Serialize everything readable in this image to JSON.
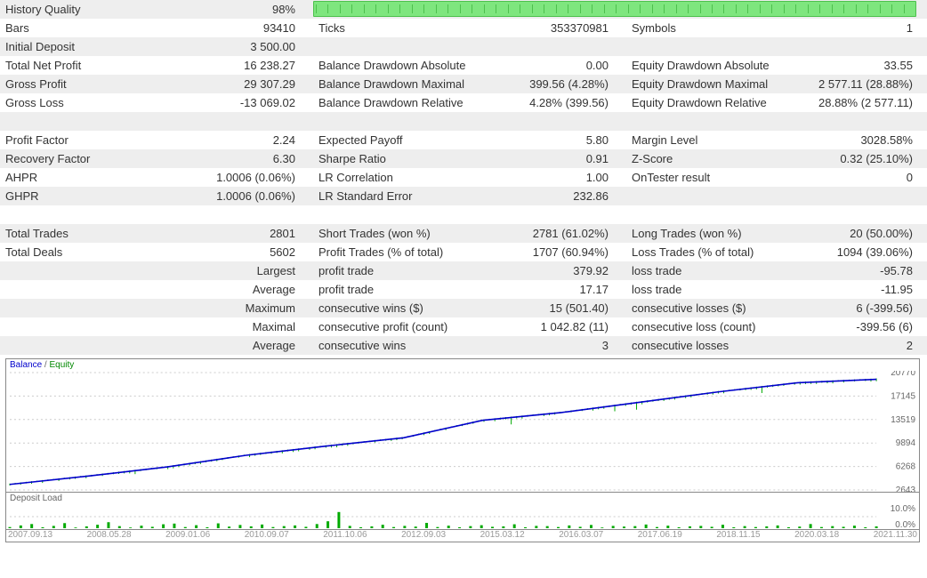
{
  "rows": [
    {
      "c1l": "History Quality",
      "c1v": "98%",
      "qbar": true
    },
    {
      "c1l": "Bars",
      "c1v": "93410",
      "c2l": "Ticks",
      "c2v": "353370981",
      "c3l": "Symbols",
      "c3v": "1"
    },
    {
      "c1l": "Initial Deposit",
      "c1v": "3 500.00",
      "c2l": "",
      "c2v": "",
      "c3l": "",
      "c3v": ""
    },
    {
      "c1l": "Total Net Profit",
      "c1v": "16 238.27",
      "c2l": "Balance Drawdown Absolute",
      "c2v": "0.00",
      "c3l": "Equity Drawdown Absolute",
      "c3v": "33.55"
    },
    {
      "c1l": "Gross Profit",
      "c1v": "29 307.29",
      "c2l": "Balance Drawdown Maximal",
      "c2v": "399.56 (4.28%)",
      "c3l": "Equity Drawdown Maximal",
      "c3v": "2 577.11 (28.88%)"
    },
    {
      "c1l": "Gross Loss",
      "c1v": "-13 069.02",
      "c2l": "Balance Drawdown Relative",
      "c2v": "4.28% (399.56)",
      "c3l": "Equity Drawdown Relative",
      "c3v": "28.88% (2 577.11)"
    },
    {
      "blank": true
    },
    {
      "c1l": "Profit Factor",
      "c1v": "2.24",
      "c2l": "Expected Payoff",
      "c2v": "5.80",
      "c3l": "Margin Level",
      "c3v": "3028.58%"
    },
    {
      "c1l": "Recovery Factor",
      "c1v": "6.30",
      "c2l": "Sharpe Ratio",
      "c2v": "0.91",
      "c3l": "Z-Score",
      "c3v": "0.32 (25.10%)"
    },
    {
      "c1l": "AHPR",
      "c1v": "1.0006 (0.06%)",
      "c2l": "LR Correlation",
      "c2v": "1.00",
      "c3l": "OnTester result",
      "c3v": "0"
    },
    {
      "c1l": "GHPR",
      "c1v": "1.0006 (0.06%)",
      "c2l": "LR Standard Error",
      "c2v": "232.86",
      "c3l": "",
      "c3v": ""
    },
    {
      "blank": true
    },
    {
      "c1l": "Total Trades",
      "c1v": "2801",
      "c2l": "Short Trades (won %)",
      "c2v": "2781 (61.02%)",
      "c3l": "Long Trades (won %)",
      "c3v": "20 (50.00%)"
    },
    {
      "c1l": "Total Deals",
      "c1v": "5602",
      "c2l": "Profit Trades (% of total)",
      "c2v": "1707 (60.94%)",
      "c3l": "Loss Trades (% of total)",
      "c3v": "1094 (39.06%)"
    },
    {
      "c1l": "",
      "c1v": "Largest",
      "c2l": "profit trade",
      "c2v": "379.92",
      "c3l": "loss trade",
      "c3v": "-95.78"
    },
    {
      "c1l": "",
      "c1v": "Average",
      "c2l": "profit trade",
      "c2v": "17.17",
      "c3l": "loss trade",
      "c3v": "-11.95"
    },
    {
      "c1l": "",
      "c1v": "Maximum",
      "c2l": "consecutive wins ($)",
      "c2v": "15 (501.40)",
      "c3l": "consecutive losses ($)",
      "c3v": "6 (-399.56)"
    },
    {
      "c1l": "",
      "c1v": "Maximal",
      "c2l": "consecutive profit (count)",
      "c2v": "1 042.82 (11)",
      "c3l": "consecutive loss (count)",
      "c3v": "-399.56 (6)"
    },
    {
      "c1l": "",
      "c1v": "Average",
      "c2l": "consecutive wins",
      "c2v": "3",
      "c3l": "consecutive losses",
      "c3v": "2"
    }
  ],
  "chart": {
    "legend_balance": "Balance",
    "legend_sep": " / ",
    "legend_equity": "Equity",
    "deposit_label": "Deposit Load",
    "deposit_max": "10.0%",
    "deposit_min": "0.0%",
    "yticks": [
      "20770",
      "17145",
      "13519",
      "9894",
      "6268",
      "2643"
    ],
    "xticks": [
      "2007.09.13",
      "2008.05.28",
      "2009.01.06",
      "2010.09.07",
      "2011.10.06",
      "2012.09.03",
      "2015.03.12",
      "2016.03.07",
      "2017.06.19",
      "2018.11.15",
      "2020.03.18",
      "2021.11.30"
    ]
  },
  "chart_data": {
    "type": "line",
    "title": "Balance / Equity",
    "ylabel": "",
    "xlabel": "",
    "ylim_balance": [
      2643,
      20770
    ],
    "series": [
      {
        "name": "Balance",
        "x": [
          "2007.09.13",
          "2008.05.28",
          "2009.01.06",
          "2010.09.07",
          "2011.10.06",
          "2012.09.03",
          "2015.03.12",
          "2016.03.07",
          "2017.06.19",
          "2018.11.15",
          "2020.03.18",
          "2021.11.30"
        ],
        "values": [
          3500,
          4800,
          6200,
          8000,
          9400,
          10700,
          13400,
          14600,
          16200,
          17800,
          19200,
          19738
        ]
      },
      {
        "name": "Equity",
        "x": [
          "2007.09.13",
          "2008.05.28",
          "2009.01.06",
          "2010.09.07",
          "2011.10.06",
          "2012.09.03",
          "2015.03.12",
          "2016.03.07",
          "2017.06.19",
          "2018.11.15",
          "2020.03.18",
          "2021.11.30"
        ],
        "values": [
          3500,
          4700,
          6200,
          7900,
          9300,
          10600,
          13300,
          14500,
          16100,
          17700,
          19100,
          19738
        ]
      },
      {
        "name": "Deposit Load",
        "ylim": [
          0,
          10
        ],
        "values_pct": [
          0.5,
          1.2,
          1.8,
          0.4,
          1.0,
          2.2,
          0.3,
          0.8,
          1.5,
          2.6,
          0.9,
          0.3,
          1.1,
          0.6,
          1.7,
          2.0,
          0.5,
          1.3,
          0.4,
          2.1,
          0.7,
          1.4,
          0.8,
          1.6,
          0.5,
          0.9,
          1.2,
          0.6,
          1.8,
          3.0,
          7.0,
          1.0,
          0.4,
          0.8,
          1.5,
          0.5,
          1.0,
          0.7,
          2.3,
          0.5,
          1.1,
          0.4,
          0.9,
          1.3,
          0.6,
          0.8,
          1.7,
          0.4,
          1.0,
          0.9,
          0.5,
          1.2,
          0.6,
          1.4,
          0.3,
          1.0,
          0.7,
          0.9,
          1.6,
          0.5,
          1.1,
          0.4,
          0.8,
          1.0,
          0.6,
          1.5,
          0.4,
          0.9,
          0.5,
          0.8,
          1.2,
          0.4,
          0.7,
          1.8,
          0.5,
          0.9,
          0.6,
          1.1,
          0.4,
          0.8
        ]
      }
    ]
  }
}
